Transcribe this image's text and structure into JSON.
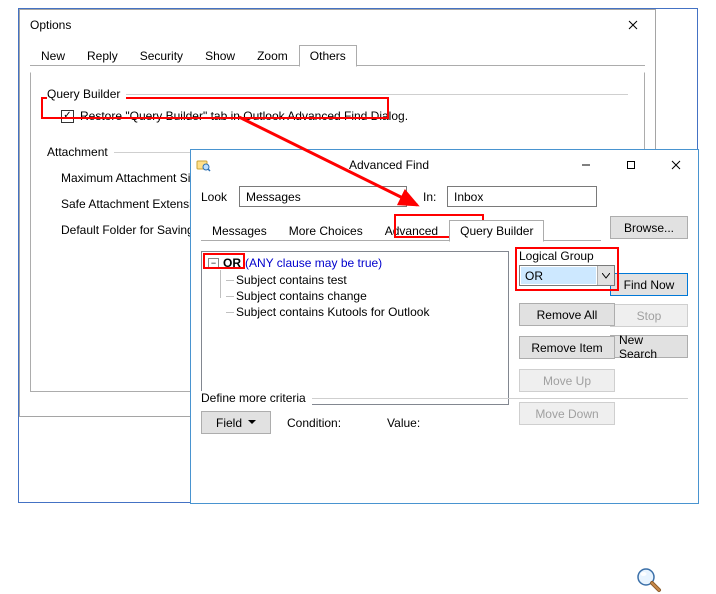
{
  "options": {
    "title": "Options",
    "tabs": [
      "New",
      "Reply",
      "Security",
      "Show",
      "Zoom",
      "Others"
    ],
    "activeTab": 5,
    "query_builder_group": "Query Builder",
    "restore_label": "Restore \"Query Builder\" tab in Outlook Advanced Find Dialog.",
    "attachment_group": "Attachment",
    "attachment_items": [
      "Maximum Attachment Size",
      "Safe Attachment Extension",
      "Default Folder for Saving A"
    ]
  },
  "af": {
    "title": "Advanced Find",
    "look_label": "Look",
    "look_value": "Messages",
    "in_label": "In:",
    "in_value": "Inbox",
    "browse": "Browse...",
    "tabs": [
      "Messages",
      "More Choices",
      "Advanced",
      "Query Builder"
    ],
    "activeTab": 3,
    "find_now": "Find Now",
    "stop": "Stop",
    "new_search": "New Search",
    "logical_group_label": "Logical Group",
    "logical_group_value": "OR",
    "remove_all": "Remove All",
    "remove_item": "Remove Item",
    "move_up": "Move Up",
    "move_down": "Move Down",
    "tree": {
      "root_op": "OR",
      "root_hint": "(ANY clause may be true)",
      "items": [
        "Subject contains test",
        "Subject contains change",
        "Subject contains Kutools for Outlook"
      ]
    },
    "define_label": "Define more criteria",
    "field_btn": "Field",
    "condition_label": "Condition:",
    "value_label": "Value:"
  },
  "colors": {
    "red": "#ff0000",
    "blue": "#4472c4"
  }
}
